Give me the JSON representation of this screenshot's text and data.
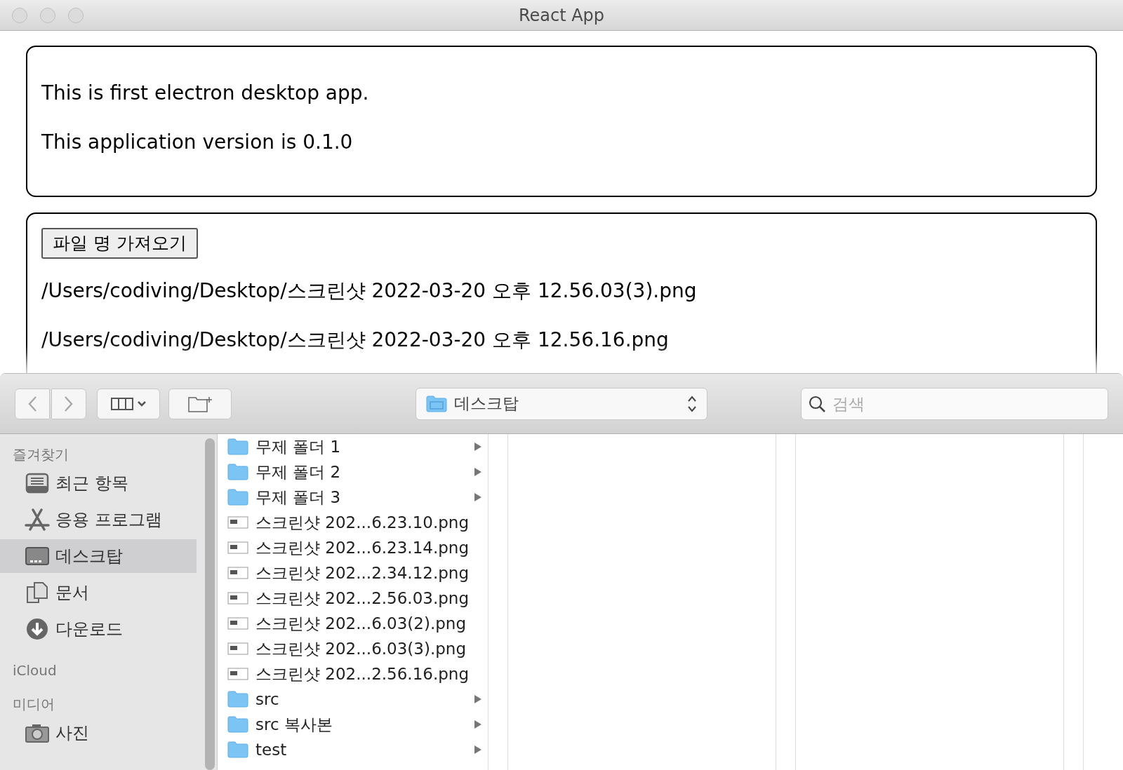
{
  "window": {
    "title": "React App"
  },
  "info_card": {
    "lines": [
      "This is first electron desktop app.",
      "This application version is 0.1.0"
    ]
  },
  "files_card": {
    "button": "파일 명 가져오기",
    "paths": [
      "/Users/codiving/Desktop/스크린샷 2022-03-20 오후 12.56.03(3).png",
      "/Users/codiving/Desktop/스크린샷 2022-03-20 오후 12.56.16.png"
    ]
  },
  "dialog": {
    "location": "데스크탑",
    "search": {
      "placeholder": "검색"
    },
    "sidebar": [
      {
        "heading": "즐겨찾기",
        "items": [
          {
            "label": "최근 항목",
            "kind": "recents",
            "selected": false
          },
          {
            "label": "응용 프로그램",
            "kind": "apps",
            "selected": false
          },
          {
            "label": "데스크탑",
            "kind": "desktop",
            "selected": true
          },
          {
            "label": "문서",
            "kind": "documents",
            "selected": false
          },
          {
            "label": "다운로드",
            "kind": "downloads",
            "selected": false
          }
        ]
      },
      {
        "heading": "iCloud"
      },
      {
        "heading": "미디어",
        "items": [
          {
            "label": "사진",
            "kind": "photos",
            "selected": false
          }
        ]
      }
    ],
    "files": [
      {
        "name": "무제 폴더 1",
        "kind": "folder"
      },
      {
        "name": "무제 폴더 2",
        "kind": "folder"
      },
      {
        "name": "무제 폴더 3",
        "kind": "folder"
      },
      {
        "name": "스크린샷 202...6.23.10.png",
        "kind": "image"
      },
      {
        "name": "스크린샷 202...6.23.14.png",
        "kind": "image"
      },
      {
        "name": "스크린샷 202...2.34.12.png",
        "kind": "image"
      },
      {
        "name": "스크린샷 202...2.56.03.png",
        "kind": "image"
      },
      {
        "name": "스크린샷 202...6.03(2).png",
        "kind": "image"
      },
      {
        "name": "스크린샷 202...6.03(3).png",
        "kind": "image"
      },
      {
        "name": "스크린샷 202...2.56.16.png",
        "kind": "image"
      },
      {
        "name": "src",
        "kind": "folder"
      },
      {
        "name": "src 복사본",
        "kind": "folder"
      },
      {
        "name": "test",
        "kind": "folder"
      }
    ]
  }
}
